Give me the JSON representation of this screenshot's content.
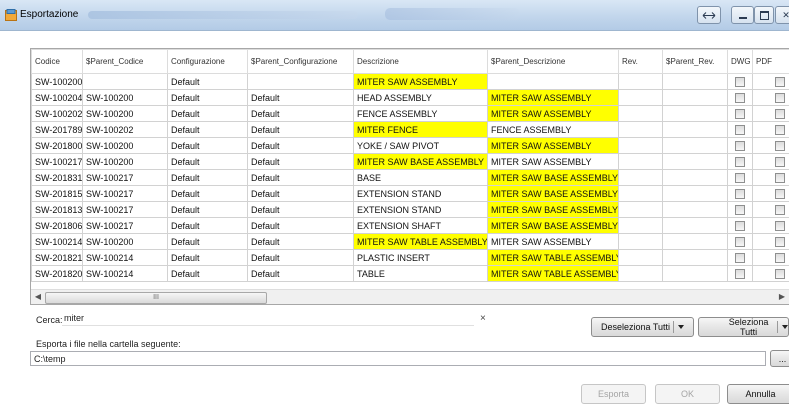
{
  "window": {
    "title": "Esportazione"
  },
  "table": {
    "columns": [
      "Codice",
      "$Parent_Codice",
      "Configurazione",
      "$Parent_Configurazione",
      "Descrizione",
      "$Parent_Descrizione",
      "Rev.",
      "$Parent_Rev.",
      "DWG",
      "PDF"
    ],
    "rows": [
      {
        "codice": "SW-100200",
        "parent_codice": "",
        "config": "Default",
        "parent_config": "",
        "desc": "MITER SAW ASSEMBLY",
        "parent_desc": "",
        "rev": "",
        "parent_rev": "",
        "hl_desc": true,
        "hl_parent": false
      },
      {
        "codice": "SW-100204",
        "parent_codice": "SW-100200",
        "config": "Default",
        "parent_config": "Default",
        "desc": "HEAD ASSEMBLY",
        "parent_desc": "MITER SAW ASSEMBLY",
        "rev": "",
        "parent_rev": "",
        "hl_desc": false,
        "hl_parent": true
      },
      {
        "codice": "SW-100202",
        "parent_codice": "SW-100200",
        "config": "Default",
        "parent_config": "Default",
        "desc": "FENCE ASSEMBLY",
        "parent_desc": "MITER SAW ASSEMBLY",
        "rev": "",
        "parent_rev": "",
        "hl_desc": false,
        "hl_parent": true
      },
      {
        "codice": "SW-201789",
        "parent_codice": "SW-100202",
        "config": "Default",
        "parent_config": "Default",
        "desc": "MITER FENCE",
        "parent_desc": "FENCE ASSEMBLY",
        "rev": "",
        "parent_rev": "",
        "hl_desc": true,
        "hl_parent": false
      },
      {
        "codice": "SW-201800",
        "parent_codice": "SW-100200",
        "config": "Default",
        "parent_config": "Default",
        "desc": "YOKE / SAW PIVOT",
        "parent_desc": "MITER SAW ASSEMBLY",
        "rev": "",
        "parent_rev": "",
        "hl_desc": false,
        "hl_parent": true
      },
      {
        "codice": "SW-100217",
        "parent_codice": "SW-100200",
        "config": "Default",
        "parent_config": "Default",
        "desc": "MITER SAW BASE ASSEMBLY",
        "parent_desc": "MITER SAW ASSEMBLY",
        "rev": "",
        "parent_rev": "",
        "hl_desc": true,
        "hl_parent": false
      },
      {
        "codice": "SW-201831",
        "parent_codice": "SW-100217",
        "config": "Default",
        "parent_config": "Default",
        "desc": "BASE",
        "parent_desc": "MITER SAW BASE ASSEMBLY",
        "rev": "",
        "parent_rev": "",
        "hl_desc": false,
        "hl_parent": true
      },
      {
        "codice": "SW-201815",
        "parent_codice": "SW-100217",
        "config": "Default",
        "parent_config": "Default",
        "desc": "EXTENSION STAND",
        "parent_desc": "MITER SAW BASE ASSEMBLY",
        "rev": "",
        "parent_rev": "",
        "hl_desc": false,
        "hl_parent": true
      },
      {
        "codice": "SW-201813",
        "parent_codice": "SW-100217",
        "config": "Default",
        "parent_config": "Default",
        "desc": "EXTENSION STAND",
        "parent_desc": "MITER SAW BASE ASSEMBLY",
        "rev": "",
        "parent_rev": "",
        "hl_desc": false,
        "hl_parent": true
      },
      {
        "codice": "SW-201806",
        "parent_codice": "SW-100217",
        "config": "Default",
        "parent_config": "Default",
        "desc": "EXTENSION SHAFT",
        "parent_desc": "MITER SAW BASE ASSEMBLY",
        "rev": "",
        "parent_rev": "",
        "hl_desc": false,
        "hl_parent": true
      },
      {
        "codice": "SW-100214",
        "parent_codice": "SW-100200",
        "config": "Default",
        "parent_config": "Default",
        "desc": "MITER SAW TABLE ASSEMBLY",
        "parent_desc": "MITER SAW ASSEMBLY",
        "rev": "",
        "parent_rev": "",
        "hl_desc": true,
        "hl_parent": false
      },
      {
        "codice": "SW-201821",
        "parent_codice": "SW-100214",
        "config": "Default",
        "parent_config": "Default",
        "desc": "PLASTIC INSERT",
        "parent_desc": "MITER SAW TABLE ASSEMBLY",
        "rev": "",
        "parent_rev": "",
        "hl_desc": false,
        "hl_parent": true
      },
      {
        "codice": "SW-201820",
        "parent_codice": "SW-100214",
        "config": "Default",
        "parent_config": "Default",
        "desc": "TABLE",
        "parent_desc": "MITER SAW TABLE ASSEMBLY",
        "rev": "",
        "parent_rev": "",
        "hl_desc": false,
        "hl_parent": true
      }
    ]
  },
  "scrollbar": {
    "thumb_grip": "III"
  },
  "search": {
    "label": "Cerca:",
    "value": "miter",
    "clear_glyph": "×"
  },
  "buttons": {
    "deselect_all": "Deseleziona Tutti",
    "select_all": "Seleziona Tutti",
    "browse": "...",
    "export": "Esporta",
    "ok": "OK",
    "cancel": "Annulla"
  },
  "export_folder": {
    "label": "Esporta i file nella cartella seguente:",
    "path": "C:\\temp"
  },
  "colors": {
    "highlight": "#ffff00",
    "titlebar": "#c2d6ec"
  },
  "icons": {
    "app": "export-app-icon",
    "clear": "clear-search-icon"
  }
}
